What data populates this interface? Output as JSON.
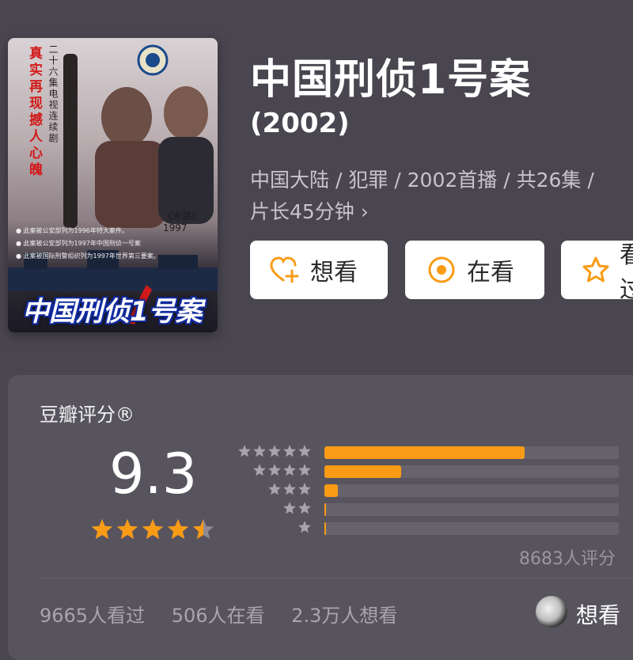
{
  "poster": {
    "slogan": "真实再现撼人心魄",
    "subtitle": "二十六集电视连续剧",
    "year_caption": "《末路》1997",
    "notes": [
      "● 此案被公安部列为1996年特大案件。",
      "● 此案被公安部列为1997年中国刑侦一号案",
      "● 此案被国际刑警组织列为1997年世界第三要案。"
    ],
    "title_art": "中国刑侦1号案"
  },
  "show": {
    "title": "中国刑侦1号案",
    "year": "(2002)",
    "meta": "中国大陆 / 犯罪 / 2002首播 / 共26集 /",
    "meta2": "片长45分钟 ›"
  },
  "actions": {
    "want": "想看",
    "watching": "在看",
    "watched": "看过"
  },
  "rating": {
    "label": "豆瓣评分®",
    "score": "9.3",
    "stars": 4.5,
    "distribution": [
      {
        "stars": 5,
        "fraction": 0.68
      },
      {
        "stars": 4,
        "fraction": 0.26
      },
      {
        "stars": 3,
        "fraction": 0.045
      },
      {
        "stars": 2,
        "fraction": 0.004
      },
      {
        "stars": 1,
        "fraction": 0.004
      }
    ],
    "count": "8683人评分"
  },
  "stats": {
    "seen": "9665人看过",
    "watching": "506人在看",
    "want": "2.3万人想看"
  },
  "footer": {
    "want_label": "想看"
  },
  "colors": {
    "background": "#4a4650",
    "accent": "#f99b15",
    "card": "#58545e"
  }
}
